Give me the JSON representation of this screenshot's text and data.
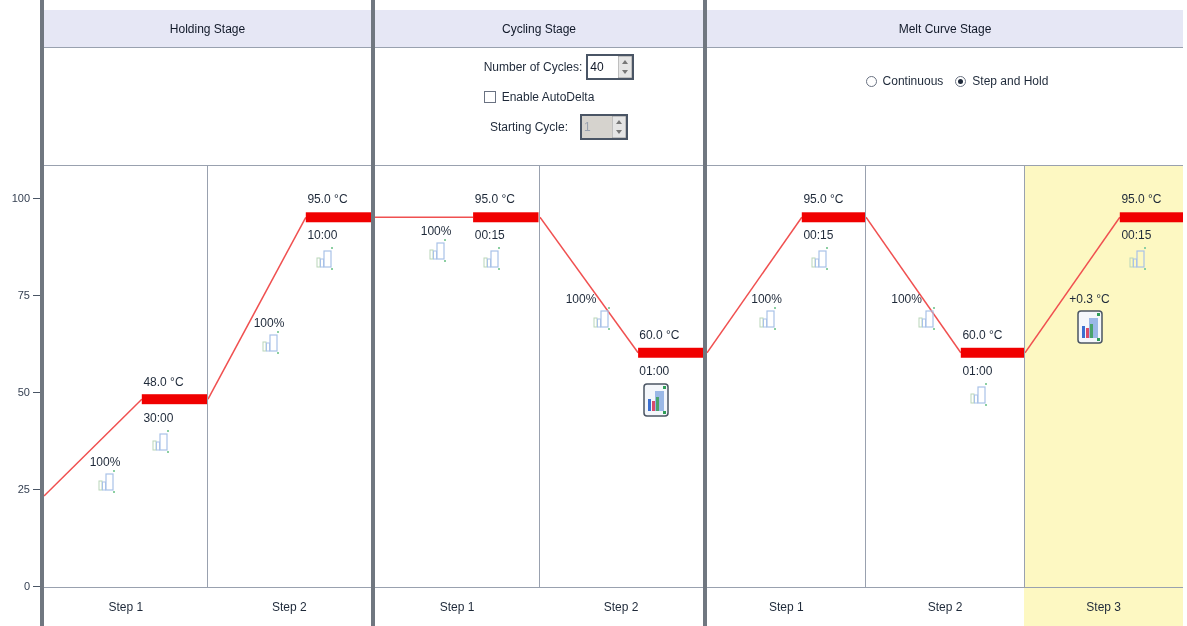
{
  "y_axis": {
    "ticks": [
      "100",
      "75",
      "50",
      "25",
      "0"
    ]
  },
  "stages": [
    {
      "kind": "holding",
      "title": "Holding Stage",
      "steps": [
        {
          "label": "Step 1",
          "selected": false,
          "temperature": "48.0 °C",
          "time": "30:00",
          "ramp": "100%",
          "ramp_collect": false,
          "hold_collect": false
        },
        {
          "label": "Step 2",
          "selected": false,
          "temperature": "95.0 °C",
          "time": "10:00",
          "ramp": "100%",
          "ramp_collect": false,
          "hold_collect": false
        }
      ]
    },
    {
      "kind": "cycling",
      "title": "Cycling Stage",
      "cycles": {
        "label": "Number of Cycles:",
        "value": "40"
      },
      "auto_delta": {
        "label": "Enable AutoDelta",
        "checked": false
      },
      "starting_cycle": {
        "label": "Starting Cycle:",
        "value": "1",
        "disabled": true
      },
      "steps": [
        {
          "label": "Step 1",
          "selected": false,
          "temperature": "95.0 °C",
          "time": "00:15",
          "ramp": "100%",
          "ramp_collect": false,
          "hold_collect": false
        },
        {
          "label": "Step 2",
          "selected": false,
          "temperature": "60.0 °C",
          "time": "01:00",
          "ramp": "100%",
          "ramp_collect": false,
          "hold_collect": true
        }
      ]
    },
    {
      "kind": "melt",
      "title": "Melt Curve Stage",
      "modes": [
        {
          "label": "Continuous",
          "selected": false
        },
        {
          "label": "Step and Hold",
          "selected": true
        }
      ],
      "steps": [
        {
          "label": "Step 1",
          "selected": false,
          "temperature": "95.0 °C",
          "time": "00:15",
          "ramp": "100%",
          "ramp_collect": false,
          "hold_collect": false
        },
        {
          "label": "Step 2",
          "selected": false,
          "temperature": "60.0 °C",
          "time": "01:00",
          "ramp": "100%",
          "ramp_collect": false,
          "hold_collect": false
        },
        {
          "label": "Step 3",
          "selected": true,
          "temperature": "95.0 °C",
          "time": "00:15",
          "ramp": "+0.3 °C",
          "ramp_collect": true,
          "hold_collect": false
        }
      ]
    }
  ]
}
